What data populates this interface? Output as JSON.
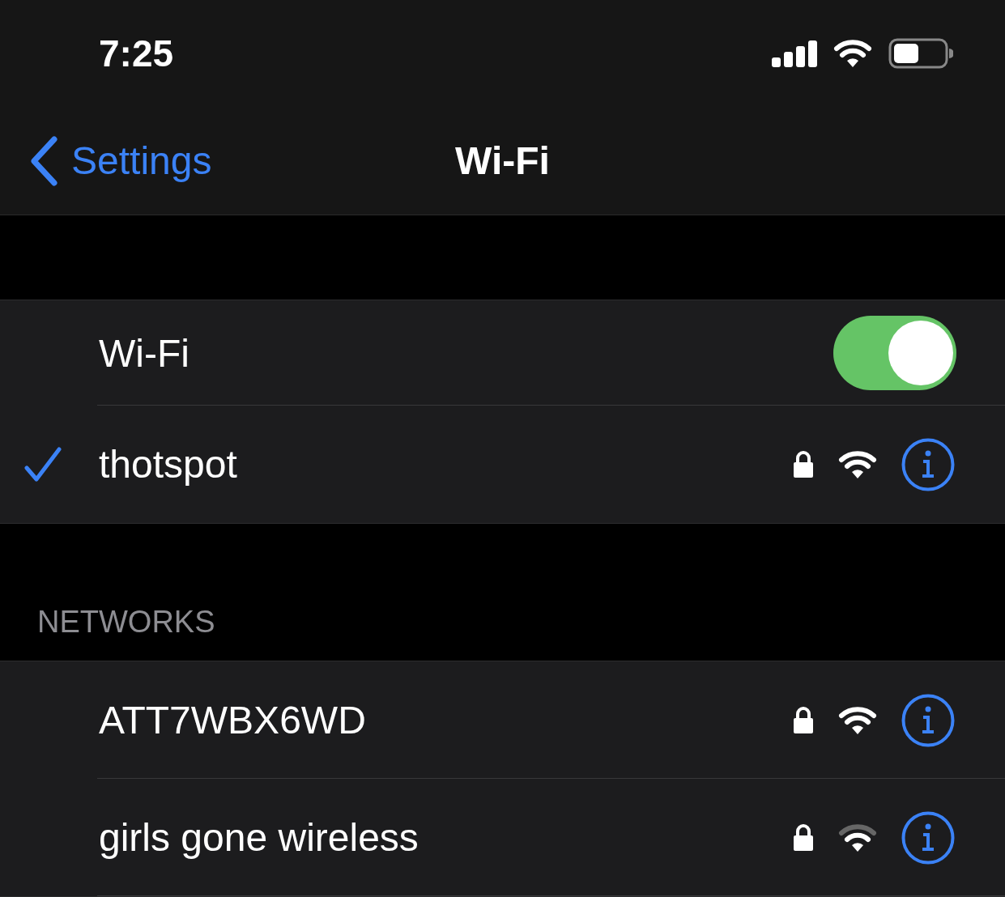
{
  "status_bar": {
    "time": "7:25"
  },
  "nav": {
    "back": "Settings",
    "title": "Wi-Fi"
  },
  "wifi_toggle": {
    "label": "Wi-Fi",
    "on": true
  },
  "connected": {
    "name": "thotspot",
    "selected": true,
    "locked": true,
    "weak_signal": false
  },
  "networks_header": "NETWORKS",
  "networks": [
    {
      "name": "ATT7WBX6WD",
      "locked": true,
      "weak_signal": false
    },
    {
      "name": "girls gone wireless",
      "locked": true,
      "weak_signal": true
    }
  ]
}
